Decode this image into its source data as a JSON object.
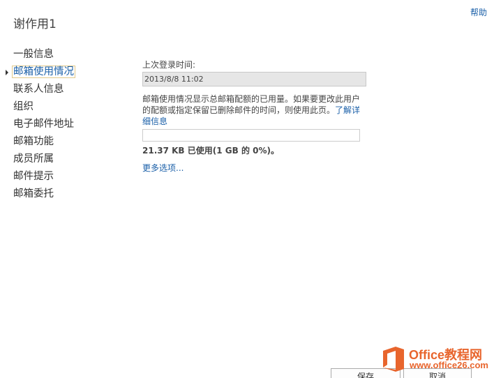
{
  "header": {
    "help_label": "帮助",
    "title": "谢作用1"
  },
  "sidebar": {
    "items": [
      {
        "label": "一般信息",
        "selected": false
      },
      {
        "label": "邮箱使用情况",
        "selected": true
      },
      {
        "label": "联系人信息",
        "selected": false
      },
      {
        "label": "组织",
        "selected": false
      },
      {
        "label": "电子邮件地址",
        "selected": false
      },
      {
        "label": "邮箱功能",
        "selected": false
      },
      {
        "label": "成员所属",
        "selected": false
      },
      {
        "label": "邮件提示",
        "selected": false
      },
      {
        "label": "邮箱委托",
        "selected": false
      }
    ]
  },
  "main": {
    "last_logon_label": "上次登录时间:",
    "last_logon_value": "2013/8/8 11:02",
    "description": "邮箱使用情况显示总邮箱配额的已用量。如果要更改此用户的配额或指定保留已删除邮件的时间，则使用此页。",
    "learn_more_label": "了解详细信息",
    "usage_percent": 0,
    "usage_text": "21.37 KB 已使用(1 GB 的 0%)。",
    "more_options_label": "更多选项..."
  },
  "footer": {
    "save_label": "保存",
    "cancel_label": "取消"
  },
  "watermark": {
    "line1": "Office教程网",
    "line2": "www.office26.com"
  },
  "colors": {
    "link": "#1a5fa8",
    "watermark_orange": "#e8652d",
    "selected_border": "#e2c98a"
  }
}
